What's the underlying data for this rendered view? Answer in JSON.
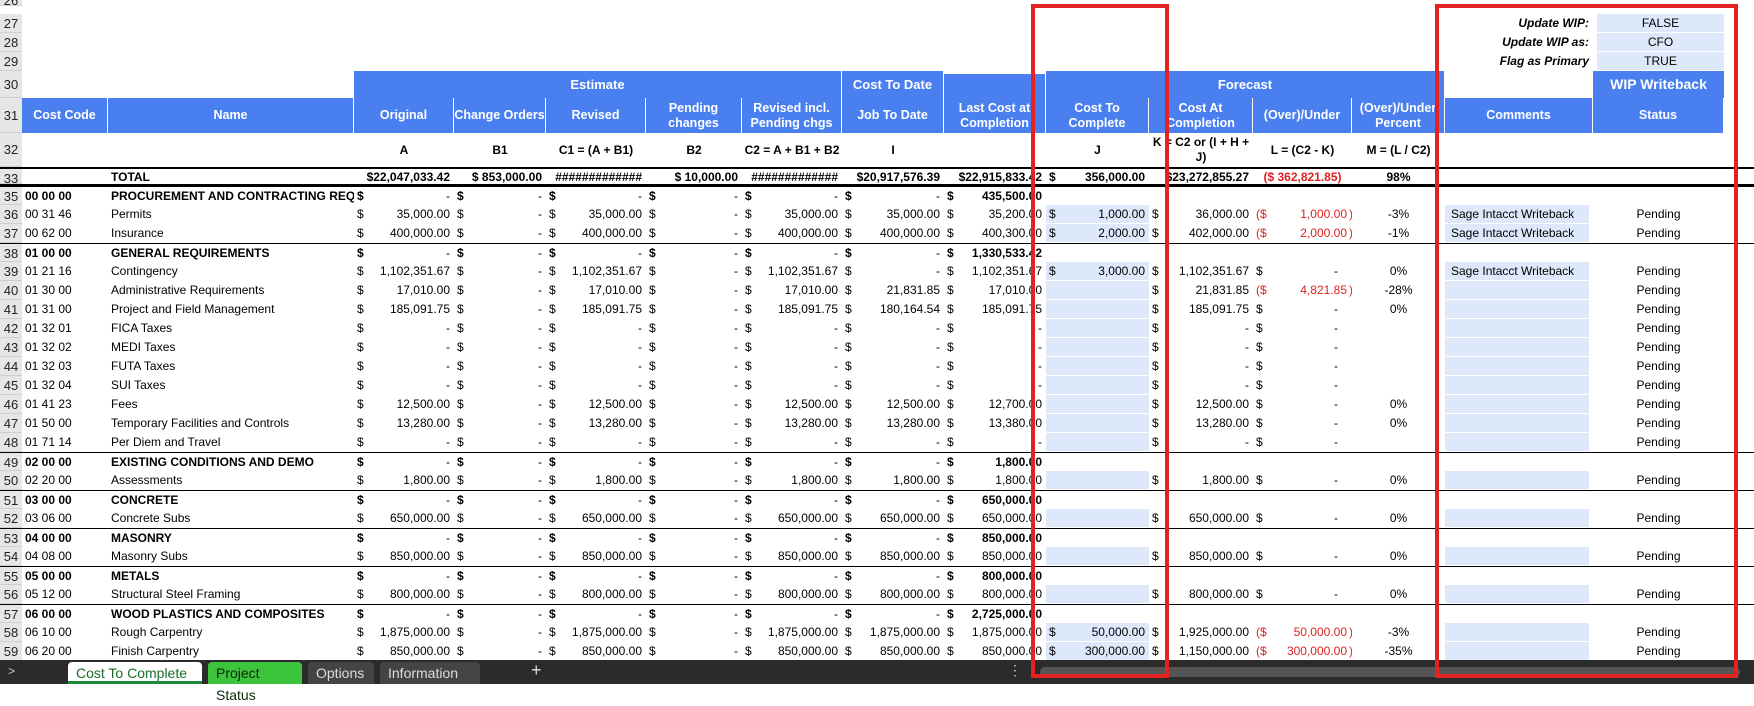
{
  "sheet": {
    "wip": {
      "update_wip_label": "Update WIP:",
      "update_wip_value": "FALSE",
      "update_wip_as_label": "Update WIP as:",
      "update_wip_as_value": "CFO",
      "flag_primary_label": "Flag as Primary",
      "flag_primary_value": "TRUE"
    },
    "groups": {
      "estimate": "Estimate",
      "cost_to_date": "Cost To Date",
      "forecast": "Forecast",
      "wip_writeback": "WIP Writeback"
    },
    "headers": [
      "Cost Code",
      "Name",
      "Original",
      "Change Orders",
      "Revised",
      "Pending changes",
      "Revised incl. Pending chgs",
      "Job To Date",
      "Last Cost at Completion",
      "Cost To Complete",
      "Cost At Completion",
      "(Over)/Under",
      "(Over)/Under Percent",
      "Comments",
      "Status"
    ],
    "formulas": [
      "",
      "",
      "A",
      "B1",
      "C1 = (A + B1)",
      "B2",
      "C2 = A + B1 + B2",
      "I",
      "",
      "J",
      "K = C2 or (I + H + J)",
      "L = (C2 - K)",
      "M = (L / C2)",
      "",
      ""
    ],
    "total": {
      "label": "TOTAL",
      "original": "$22,047,033.42",
      "change_orders": "$ 853,000.00",
      "revised": "#############",
      "pending": "$ 10,000.00",
      "revised_pending": "#############",
      "job_to_date": "$20,917,576.39",
      "last_cost": "$22,915,833.42",
      "cost_to_complete": "356,000.00",
      "cost_at_completion": "$23,272,855.27",
      "over_under": "($ 362,821.85)",
      "percent": "98%"
    },
    "row_numbers": [
      "26",
      "27",
      "28",
      "29",
      "30",
      "31",
      "32",
      "33",
      "35",
      "36",
      "37",
      "38",
      "39",
      "40",
      "41",
      "42",
      "43",
      "44",
      "45",
      "46",
      "47",
      "48",
      "49",
      "50",
      "51",
      "52",
      "53",
      "54",
      "55",
      "56",
      "57",
      "58",
      "59"
    ],
    "rows": [
      {
        "n": "35",
        "code": "00 00 00",
        "name": "PROCUREMENT AND CONTRACTING REQ",
        "cat": true,
        "orig": "-",
        "co": "-",
        "rev": "-",
        "pend": "-",
        "revp": "-",
        "jtd": "-",
        "last": "435,500.00"
      },
      {
        "n": "36",
        "code": "00 31 46",
        "name": "Permits",
        "orig": "35,000.00",
        "co": "-",
        "rev": "35,000.00",
        "pend": "-",
        "revp": "35,000.00",
        "jtd": "35,000.00",
        "last": "35,200.00",
        "ctc": "1,000.00",
        "cac": "36,000.00",
        "ou": "1,000.00",
        "ou_neg": true,
        "pct": "-3%",
        "comment": "Sage Intacct Writeback",
        "status": "Pending"
      },
      {
        "n": "37",
        "code": "00 62 00",
        "name": "Insurance",
        "orig": "400,000.00",
        "co": "-",
        "rev": "400,000.00",
        "pend": "-",
        "revp": "400,000.00",
        "jtd": "400,000.00",
        "last": "400,300.00",
        "ctc": "2,000.00",
        "cac": "402,000.00",
        "ou": "2,000.00",
        "ou_neg": true,
        "pct": "-1%",
        "comment": "Sage Intacct Writeback",
        "status": "Pending"
      },
      {
        "n": "38",
        "code": "01 00 00",
        "name": "GENERAL REQUIREMENTS",
        "cat": true,
        "orig": "-",
        "co": "-",
        "rev": "-",
        "pend": "-",
        "revp": "-",
        "jtd": "-",
        "last": "1,330,533.42"
      },
      {
        "n": "39",
        "code": "01 21 16",
        "name": "Contingency",
        "orig": "1,102,351.67",
        "co": "-",
        "rev": "1,102,351.67",
        "pend": "-",
        "revp": "1,102,351.67",
        "jtd": "-",
        "last": "1,102,351.67",
        "ctc": "3,000.00",
        "cac": "1,102,351.67",
        "ou": "-",
        "pct": "0%",
        "comment": "Sage Intacct Writeback",
        "status": "Pending"
      },
      {
        "n": "40",
        "code": "01 30 00",
        "name": "Administrative Requirements",
        "orig": "17,010.00",
        "co": "-",
        "rev": "17,010.00",
        "pend": "-",
        "revp": "17,010.00",
        "jtd": "21,831.85",
        "last": "17,010.00",
        "ctc": "",
        "cac": "21,831.85",
        "ou": "4,821.85",
        "ou_neg": true,
        "pct": "-28%",
        "comment": "",
        "status": "Pending"
      },
      {
        "n": "41",
        "code": "01 31 00",
        "name": "Project and Field Management",
        "orig": "185,091.75",
        "co": "-",
        "rev": "185,091.75",
        "pend": "-",
        "revp": "185,091.75",
        "jtd": "180,164.54",
        "last": "185,091.75",
        "ctc": "",
        "cac": "185,091.75",
        "ou": "-",
        "pct": "0%",
        "comment": "",
        "status": "Pending"
      },
      {
        "n": "42",
        "code": "01 32 01",
        "name": "FICA Taxes",
        "orig": "-",
        "co": "-",
        "rev": "-",
        "pend": "-",
        "revp": "-",
        "jtd": "-",
        "last": "-",
        "ctc": "",
        "cac": "-",
        "ou": "-",
        "pct": "",
        "comment": "",
        "status": "Pending"
      },
      {
        "n": "43",
        "code": "01 32 02",
        "name": "MEDI Taxes",
        "orig": "-",
        "co": "-",
        "rev": "-",
        "pend": "-",
        "revp": "-",
        "jtd": "-",
        "last": "-",
        "ctc": "",
        "cac": "-",
        "ou": "-",
        "pct": "",
        "comment": "",
        "status": "Pending"
      },
      {
        "n": "44",
        "code": "01 32 03",
        "name": "FUTA Taxes",
        "orig": "-",
        "co": "-",
        "rev": "-",
        "pend": "-",
        "revp": "-",
        "jtd": "-",
        "last": "-",
        "ctc": "",
        "cac": "-",
        "ou": "-",
        "pct": "",
        "comment": "",
        "status": "Pending"
      },
      {
        "n": "45",
        "code": "01 32 04",
        "name": "SUI Taxes",
        "orig": "-",
        "co": "-",
        "rev": "-",
        "pend": "-",
        "revp": "-",
        "jtd": "-",
        "last": "-",
        "ctc": "",
        "cac": "-",
        "ou": "-",
        "pct": "",
        "comment": "",
        "status": "Pending"
      },
      {
        "n": "46",
        "code": "01 41 23",
        "name": "Fees",
        "orig": "12,500.00",
        "co": "-",
        "rev": "12,500.00",
        "pend": "-",
        "revp": "12,500.00",
        "jtd": "12,500.00",
        "last": "12,700.00",
        "ctc": "",
        "cac": "12,500.00",
        "ou": "-",
        "pct": "0%",
        "comment": "",
        "status": "Pending"
      },
      {
        "n": "47",
        "code": "01 50 00",
        "name": "Temporary Facilities and Controls",
        "orig": "13,280.00",
        "co": "-",
        "rev": "13,280.00",
        "pend": "-",
        "revp": "13,280.00",
        "jtd": "13,280.00",
        "last": "13,380.00",
        "ctc": "",
        "cac": "13,280.00",
        "ou": "-",
        "pct": "0%",
        "comment": "",
        "status": "Pending"
      },
      {
        "n": "48",
        "code": "01 71 14",
        "name": "Per Diem and Travel",
        "orig": "-",
        "co": "-",
        "rev": "-",
        "pend": "-",
        "revp": "-",
        "jtd": "-",
        "last": "-",
        "ctc": "",
        "cac": "-",
        "ou": "-",
        "pct": "",
        "comment": "",
        "status": "Pending"
      },
      {
        "n": "49",
        "code": "02 00 00",
        "name": "EXISTING CONDITIONS AND DEMO",
        "cat": true,
        "orig": "-",
        "co": "-",
        "rev": "-",
        "pend": "-",
        "revp": "-",
        "jtd": "-",
        "last": "1,800.00"
      },
      {
        "n": "50",
        "code": "02 20 00",
        "name": "Assessments",
        "orig": "1,800.00",
        "co": "-",
        "rev": "1,800.00",
        "pend": "-",
        "revp": "1,800.00",
        "jtd": "1,800.00",
        "last": "1,800.00",
        "ctc": "",
        "cac": "1,800.00",
        "ou": "-",
        "pct": "0%",
        "comment": "",
        "status": "Pending"
      },
      {
        "n": "51",
        "code": "03 00 00",
        "name": "CONCRETE",
        "cat": true,
        "orig": "-",
        "co": "-",
        "rev": "-",
        "pend": "-",
        "revp": "-",
        "jtd": "-",
        "last": "650,000.00"
      },
      {
        "n": "52",
        "code": "03 06 00",
        "name": "Concrete Subs",
        "orig": "650,000.00",
        "co": "-",
        "rev": "650,000.00",
        "pend": "-",
        "revp": "650,000.00",
        "jtd": "650,000.00",
        "last": "650,000.00",
        "ctc": "",
        "cac": "650,000.00",
        "ou": "-",
        "pct": "0%",
        "comment": "",
        "status": "Pending"
      },
      {
        "n": "53",
        "code": "04 00 00",
        "name": "MASONRY",
        "cat": true,
        "orig": "-",
        "co": "-",
        "rev": "-",
        "pend": "-",
        "revp": "-",
        "jtd": "-",
        "last": "850,000.00"
      },
      {
        "n": "54",
        "code": "04 08 00",
        "name": "Masonry Subs",
        "orig": "850,000.00",
        "co": "-",
        "rev": "850,000.00",
        "pend": "-",
        "revp": "850,000.00",
        "jtd": "850,000.00",
        "last": "850,000.00",
        "ctc": "",
        "cac": "850,000.00",
        "ou": "-",
        "pct": "0%",
        "comment": "",
        "status": "Pending"
      },
      {
        "n": "55",
        "code": "05 00 00",
        "name": "METALS",
        "cat": true,
        "orig": "-",
        "co": "-",
        "rev": "-",
        "pend": "-",
        "revp": "-",
        "jtd": "-",
        "last": "800,000.00"
      },
      {
        "n": "56",
        "code": "05 12 00",
        "name": "Structural Steel Framing",
        "orig": "800,000.00",
        "co": "-",
        "rev": "800,000.00",
        "pend": "-",
        "revp": "800,000.00",
        "jtd": "800,000.00",
        "last": "800,000.00",
        "ctc": "",
        "cac": "800,000.00",
        "ou": "-",
        "pct": "0%",
        "comment": "",
        "status": "Pending"
      },
      {
        "n": "57",
        "code": "06 00 00",
        "name": "WOOD PLASTICS AND COMPOSITES",
        "cat": true,
        "orig": "-",
        "co": "-",
        "rev": "-",
        "pend": "-",
        "revp": "-",
        "jtd": "-",
        "last": "2,725,000.00"
      },
      {
        "n": "58",
        "code": "06 10 00",
        "name": "Rough Carpentry",
        "orig": "1,875,000.00",
        "co": "-",
        "rev": "1,875,000.00",
        "pend": "-",
        "revp": "1,875,000.00",
        "jtd": "1,875,000.00",
        "last": "1,875,000.00",
        "ctc": "50,000.00",
        "cac": "1,925,000.00",
        "ou": "50,000.00",
        "ou_neg": true,
        "pct": "-3%",
        "comment": "",
        "status": "Pending"
      },
      {
        "n": "59",
        "code": "06 20 00",
        "name": "Finish Carpentry",
        "orig": "850,000.00",
        "co": "-",
        "rev": "850,000.00",
        "pend": "-",
        "revp": "850,000.00",
        "jtd": "850,000.00",
        "last": "850,000.00",
        "ctc": "300,000.00",
        "cac": "1,150,000.00",
        "ou": "300,000.00",
        "ou_neg": true,
        "pct": "-35%",
        "comment": "",
        "status": "Pending"
      }
    ]
  },
  "tabs": {
    "nav_arrow": ">",
    "items": [
      {
        "label": "Cost To Complete",
        "active": true
      },
      {
        "label": "Project Status",
        "color": "#3cc43c"
      },
      {
        "label": "Options"
      },
      {
        "label": "Information"
      }
    ],
    "add": "+",
    "more": "⋮"
  },
  "colors": {
    "header_blue": "#4a7ff0",
    "input_blue": "#dde9fa",
    "highlight_red": "#e52222",
    "negative_red": "#e02020"
  }
}
